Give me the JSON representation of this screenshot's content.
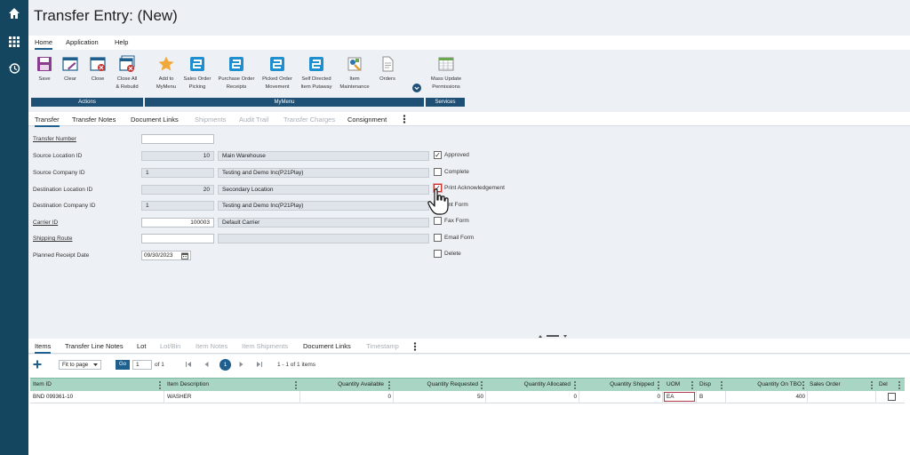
{
  "page_title": "Transfer Entry: (New)",
  "menu": [
    "Home",
    "Application",
    "Help"
  ],
  "ribbon": {
    "buttons": {
      "save": "Save",
      "clear": "Clear",
      "close": "Close",
      "close_all_1": "Close All",
      "close_all_2": "& Rebuild",
      "add_mymenu_1": "Add to",
      "add_mymenu_2": "MyMenu",
      "sales_order_1": "Sales Order",
      "sales_order_2": "Picking",
      "purchase_order_1": "Purchase Order",
      "purchase_order_2": "Receipts",
      "picked_order_1": "Picked Order",
      "picked_order_2": "Movement",
      "self_directed_1": "Self Directed",
      "self_directed_2": "Item Putaway",
      "item_maint_1": "Item",
      "item_maint_2": "Maintenance",
      "orders": "Orders",
      "mass_update_1": "Mass Update",
      "mass_update_2": "Permissions"
    },
    "groups": {
      "actions": "Actions",
      "mymenu": "MyMenu",
      "services": "Services"
    },
    "colors": {
      "group_bar": "#1e4f75",
      "accent": "#1e5f8d"
    }
  },
  "header_tabs": [
    "Transfer",
    "Transfer Notes",
    "Document Links",
    "Shipments",
    "Audit Trail",
    "Transfer Charges",
    "Consignment"
  ],
  "form": {
    "labels": {
      "transfer_number": "Transfer Number",
      "source_location_id": "Source Location ID",
      "source_company_id": "Source Company ID",
      "destination_location_id": "Destination Location ID",
      "destination_company_id": "Destination Company ID",
      "carrier_id": "Carrier ID",
      "shipping_route": "Shipping Route",
      "planned_receipt_date": "Planned Receipt Date"
    },
    "values": {
      "source_location_id": "10",
      "source_location_name": "Main Warehouse",
      "source_company_id": "1",
      "source_company_name": "Testing and Demo Inc(P21Play)",
      "destination_location_id": "20",
      "destination_location_name": "Secondary Location",
      "destination_company_id": "1",
      "destination_company_name": "Testing and Demo Inc(P21Play)",
      "carrier_id": "100003",
      "carrier_name": "Default Carrier",
      "planned_receipt_date": "09/30/2023"
    },
    "checkboxes": {
      "approved": "Approved",
      "complete": "Complete",
      "print_ack": "Print Acknowledgement",
      "print_form": "Print Form",
      "print_form_visible": "int Form",
      "fax_form": "Fax Form",
      "fax_form_visible": "Fax Form",
      "email_form": "Email Form",
      "delete": "Delete"
    }
  },
  "detail_tabs": [
    "Items",
    "Transfer Line Notes",
    "Lot",
    "Lot/Bin",
    "Item Notes",
    "Item Shipments",
    "Document Links",
    "Timestamp"
  ],
  "grid_toolbar": {
    "fit_to_page": "Fit to page",
    "go": "Go",
    "page_input": "1",
    "of": "of 1",
    "current_page": "1",
    "range": "1 - 1 of 1 items"
  },
  "grid": {
    "columns": [
      "Item ID",
      "Item Description",
      "Quantity Available",
      "Quantity Requested",
      "Quantity Allocated",
      "Quantity Shipped",
      "UOM",
      "Disp",
      "Quantity On TBO",
      "Sales Order",
      "Del"
    ],
    "rows": [
      [
        "BND 099361-10",
        "WASHER",
        "0",
        "50",
        "0",
        "0",
        "EA",
        "B",
        "400",
        "",
        ""
      ]
    ],
    "header_color": "#a9d5c4"
  }
}
